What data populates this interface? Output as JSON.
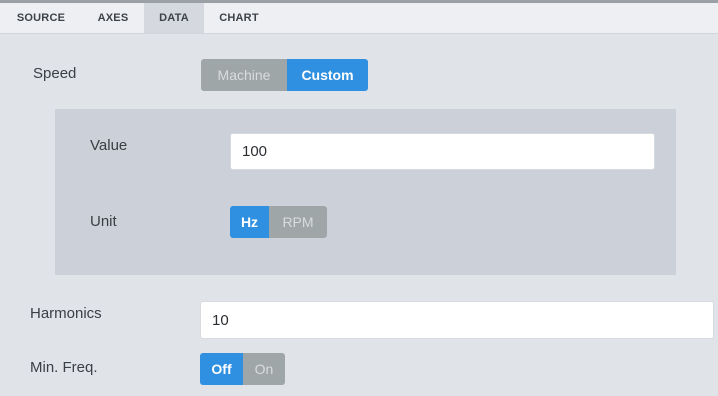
{
  "tabs": [
    {
      "label": "SOURCE"
    },
    {
      "label": "AXES"
    },
    {
      "label": "DATA"
    },
    {
      "label": "CHART"
    }
  ],
  "active_tab": "DATA",
  "speed": {
    "label": "Speed",
    "options": [
      "Machine",
      "Custom"
    ],
    "selected": "Custom"
  },
  "custom": {
    "value_label": "Value",
    "value": "100",
    "unit_label": "Unit",
    "unit_options": [
      "Hz",
      "RPM"
    ],
    "unit_selected": "Hz"
  },
  "harmonics": {
    "label": "Harmonics",
    "value": "10"
  },
  "min_freq": {
    "label": "Min. Freq.",
    "options": [
      "Off",
      "On"
    ],
    "selected": "Off"
  },
  "colors": {
    "accent": "#2f8fe0",
    "inactive_segment": "#9fa6a8",
    "panel_bg": "#e0e3e8",
    "inset_bg": "#ccd0d8"
  }
}
